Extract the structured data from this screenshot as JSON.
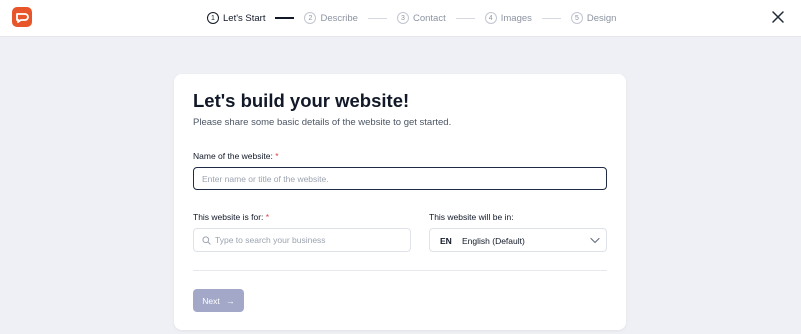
{
  "header": {
    "logo_icon": "brand-logo",
    "steps": [
      {
        "num": "1",
        "label": "Let's Start",
        "active": true
      },
      {
        "num": "2",
        "label": "Describe",
        "active": false
      },
      {
        "num": "3",
        "label": "Contact",
        "active": false
      },
      {
        "num": "4",
        "label": "Images",
        "active": false
      },
      {
        "num": "5",
        "label": "Design",
        "active": false
      }
    ],
    "close_icon": "close-icon"
  },
  "form": {
    "title": "Let's build your website!",
    "subtitle": "Please share some basic details of the website to get started.",
    "name_label": "Name of the website:",
    "required_mark": "*",
    "name_placeholder": "Enter name or title of the website.",
    "name_value": "",
    "for_label": "This website is for:",
    "for_placeholder": "Type to search your business",
    "lang_label": "This website will be in:",
    "lang_code": "EN",
    "lang_name": "English (Default)",
    "next_label": "Next",
    "next_arrow": "→"
  },
  "colors": {
    "brand": "#e8552a",
    "background": "#eff0f5",
    "required": "#e03e3e",
    "next_button": "#a3a8c8"
  }
}
